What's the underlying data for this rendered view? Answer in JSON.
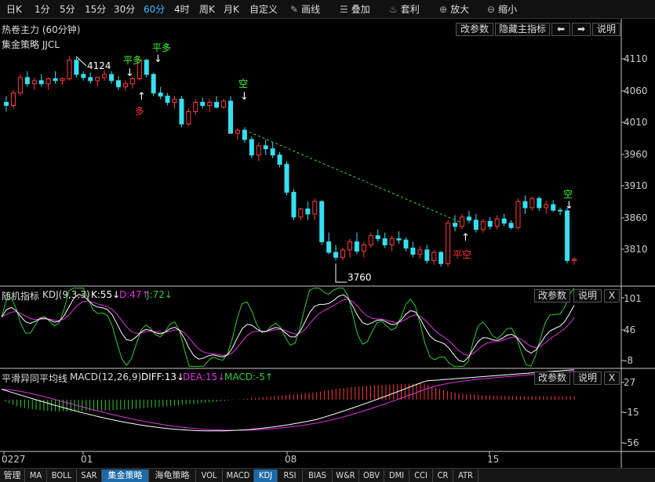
{
  "toolbar": {
    "periods": [
      "日K",
      "1分",
      "5分",
      "15分",
      "30分",
      "60分",
      "4时",
      "周K",
      "月K",
      "自定义"
    ],
    "active_period": "60分",
    "tools": [
      {
        "icon": "pencil-icon",
        "label": "画线"
      },
      {
        "icon": "stack-icon",
        "label": "叠加"
      },
      {
        "icon": "money-bag-icon",
        "label": "套利"
      },
      {
        "icon": "zoom-in-icon",
        "label": "放大"
      },
      {
        "icon": "zoom-out-icon",
        "label": "缩小"
      }
    ]
  },
  "main_panel": {
    "title": "热卷主力 (60分钟)",
    "strategy": "集金策略 JJCL",
    "buttons": {
      "edit_params": "改参数",
      "hide_indicator": "隐藏主指标",
      "prev": "⬅",
      "next": "➡",
      "help": "说明"
    },
    "y_ticks": [
      "4110",
      "4060",
      "4010",
      "3960",
      "3910",
      "3860",
      "3810"
    ],
    "high_label": "4124",
    "low_label": "3760",
    "signals": [
      "平多",
      "平多",
      "多",
      "空",
      "平空",
      "空"
    ]
  },
  "kdj_panel": {
    "name": "随机指标",
    "params": "KDJ(9,3,3)",
    "k": "K:55↓",
    "d": "D:47↑",
    "j": "J:72↓",
    "y_ticks": [
      "101",
      "46",
      "-8"
    ],
    "buttons": {
      "edit_params": "改参数",
      "help": "说明",
      "close": "X"
    }
  },
  "macd_panel": {
    "name": "平滑异同平均线",
    "params": "MACD(12,26,9)",
    "diff": "DIFF:13↓",
    "dea": "DEA:15↓",
    "macd": "MACD:-5↑",
    "y_ticks": [
      "27",
      "-15",
      "-56"
    ],
    "buttons": {
      "edit_params": "改参数",
      "help": "说明",
      "close": "X"
    }
  },
  "x_axis": {
    "labels": [
      "0227",
      "01",
      "08",
      "15"
    ]
  },
  "bottom_tabs": [
    "管理",
    "MA",
    "BOLL",
    "SAR",
    "集金策略",
    "海龟策略",
    "VOL",
    "MACD",
    "KDJ",
    "RSI",
    "BIAS",
    "W&R",
    "OBV",
    "DMI",
    "CCI",
    "CR",
    "ATR"
  ],
  "active_tabs": [
    "集金策略",
    "KDJ"
  ],
  "colors": {
    "up": "#ff3b3b",
    "down": "#35e0f0",
    "macd_dea": "#e030e0",
    "kdj_j": "#2ecc2e",
    "signal_green": "#33ff33",
    "signal_red": "#ff3333",
    "trend_line": "#33dd33",
    "active_blue": "#3fb6ff",
    "yellow_label": "#ffff00"
  },
  "chart_data": {
    "type": "candlestick",
    "y_range": [
      3760,
      4124
    ],
    "candles": [
      [
        4050,
        4060,
        4035,
        4045
      ],
      [
        4045,
        4070,
        4040,
        4065
      ],
      [
        4065,
        4095,
        4060,
        4090
      ],
      [
        4090,
        4100,
        4075,
        4080
      ],
      [
        4080,
        4090,
        4070,
        4085
      ],
      [
        4085,
        4095,
        4075,
        4080
      ],
      [
        4080,
        4090,
        4070,
        4088
      ],
      [
        4088,
        4100,
        4080,
        4085
      ],
      [
        4085,
        4090,
        4078,
        4088
      ],
      [
        4088,
        4124,
        4085,
        4118
      ],
      [
        4118,
        4122,
        4090,
        4095
      ],
      [
        4095,
        4100,
        4085,
        4090
      ],
      [
        4090,
        4098,
        4080,
        4085
      ],
      [
        4085,
        4092,
        4075,
        4090
      ],
      [
        4090,
        4102,
        4085,
        4095
      ],
      [
        4095,
        4100,
        4080,
        4085
      ],
      [
        4085,
        4092,
        4070,
        4075
      ],
      [
        4075,
        4085,
        4068,
        4080
      ],
      [
        4080,
        4090,
        4072,
        4088
      ],
      [
        4088,
        4120,
        4085,
        4118
      ],
      [
        4118,
        4120,
        4090,
        4095
      ],
      [
        4095,
        4098,
        4060,
        4065
      ],
      [
        4065,
        4075,
        4055,
        4060
      ],
      [
        4060,
        4065,
        4045,
        4050
      ],
      [
        4050,
        4060,
        4040,
        4055
      ],
      [
        4055,
        4060,
        4010,
        4015
      ],
      [
        4015,
        4040,
        4012,
        4035
      ],
      [
        4035,
        4055,
        4030,
        4050
      ],
      [
        4050,
        4058,
        4040,
        4045
      ],
      [
        4045,
        4055,
        4035,
        4050
      ],
      [
        4050,
        4060,
        4040,
        4042
      ],
      [
        4042,
        4055,
        4040,
        4052
      ],
      [
        4052,
        4060,
        4020,
        4000
      ],
      [
        4000,
        4008,
        3990,
        4005
      ],
      [
        4005,
        4010,
        3985,
        3990
      ],
      [
        3990,
        3995,
        3960,
        3965
      ],
      [
        3965,
        3985,
        3955,
        3980
      ],
      [
        3980,
        3990,
        3965,
        3975
      ],
      [
        3975,
        3985,
        3960,
        3965
      ],
      [
        3965,
        3970,
        3945,
        3950
      ],
      [
        3950,
        3955,
        3900,
        3905
      ],
      [
        3905,
        3910,
        3860,
        3865
      ],
      [
        3865,
        3880,
        3860,
        3878
      ],
      [
        3878,
        3890,
        3860,
        3870
      ],
      [
        3870,
        3895,
        3860,
        3890
      ],
      [
        3890,
        3892,
        3820,
        3825
      ],
      [
        3825,
        3840,
        3805,
        3808
      ],
      [
        3808,
        3820,
        3795,
        3800
      ],
      [
        3800,
        3815,
        3795,
        3812
      ],
      [
        3812,
        3830,
        3800,
        3825
      ],
      [
        3825,
        3840,
        3805,
        3810
      ],
      [
        3810,
        3825,
        3800,
        3820
      ],
      [
        3820,
        3840,
        3815,
        3835
      ],
      [
        3835,
        3845,
        3825,
        3830
      ],
      [
        3830,
        3840,
        3815,
        3820
      ],
      [
        3820,
        3835,
        3810,
        3830
      ],
      [
        3830,
        3842,
        3822,
        3828
      ],
      [
        3828,
        3832,
        3810,
        3815
      ],
      [
        3815,
        3825,
        3800,
        3805
      ],
      [
        3805,
        3818,
        3798,
        3812
      ],
      [
        3812,
        3820,
        3790,
        3795
      ],
      [
        3795,
        3812,
        3788,
        3808
      ],
      [
        3808,
        3810,
        3785,
        3790
      ],
      [
        3790,
        3860,
        3785,
        3855
      ],
      [
        3855,
        3868,
        3842,
        3850
      ],
      [
        3850,
        3870,
        3845,
        3865
      ],
      [
        3865,
        3875,
        3855,
        3860
      ],
      [
        3860,
        3870,
        3840,
        3845
      ],
      [
        3845,
        3862,
        3840,
        3858
      ],
      [
        3858,
        3865,
        3845,
        3850
      ],
      [
        3850,
        3868,
        3845,
        3862
      ],
      [
        3862,
        3870,
        3850,
        3855
      ],
      [
        3855,
        3860,
        3845,
        3848
      ],
      [
        3848,
        3895,
        3845,
        3890
      ],
      [
        3890,
        3900,
        3870,
        3880
      ],
      [
        3880,
        3898,
        3875,
        3895
      ],
      [
        3895,
        3898,
        3875,
        3880
      ],
      [
        3880,
        3890,
        3870,
        3885
      ],
      [
        3885,
        3892,
        3873,
        3876
      ],
      [
        3876,
        3880,
        3868,
        3875
      ],
      [
        3875,
        3880,
        3790,
        3795
      ],
      [
        3795,
        3800,
        3788,
        3797
      ]
    ],
    "kdj": {
      "range": [
        -8,
        101
      ],
      "k_last": 55,
      "d_last": 47,
      "j_last": 72
    },
    "macd": {
      "range": [
        -56,
        27
      ],
      "diff_last": 13,
      "dea_last": 15,
      "macd_last": -5
    }
  }
}
